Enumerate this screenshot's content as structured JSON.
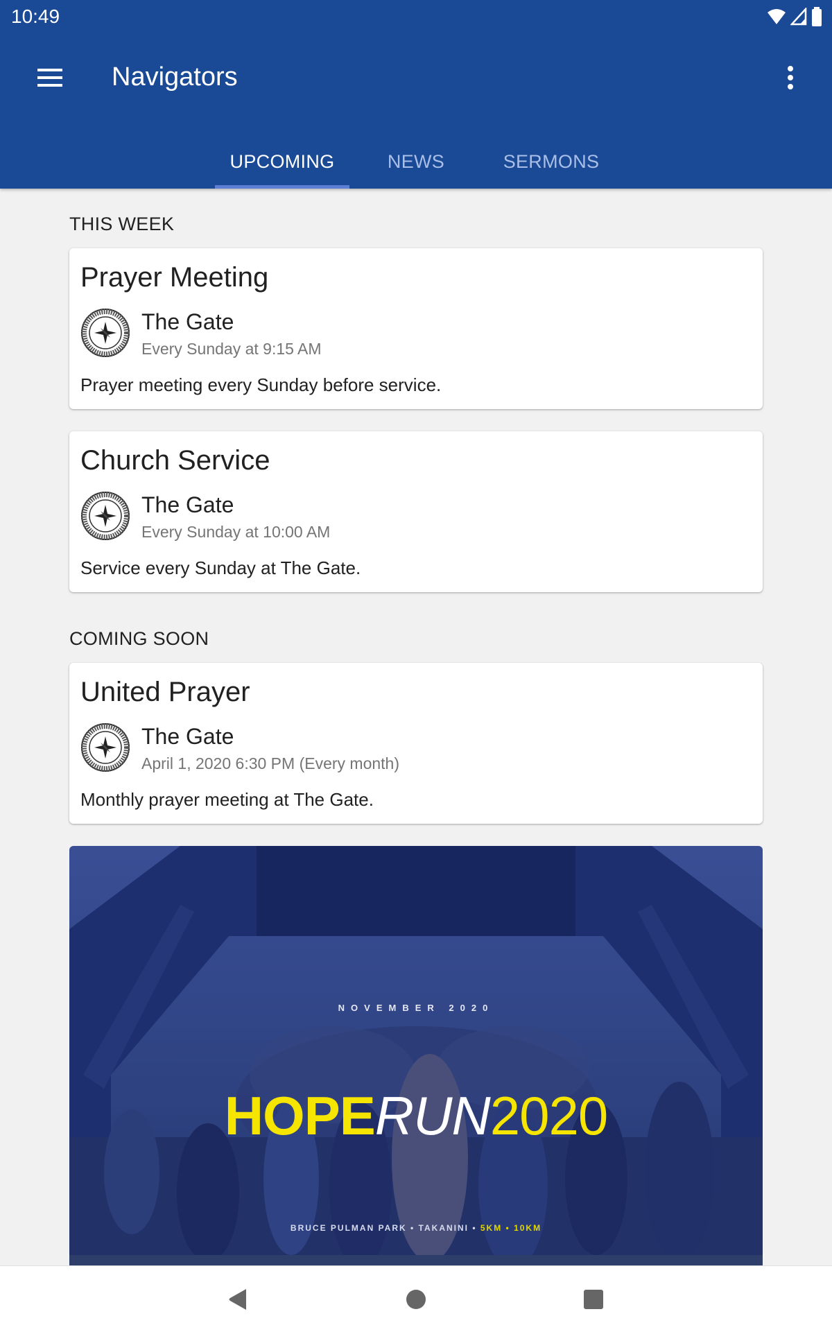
{
  "status_bar": {
    "time": "10:49",
    "icons": [
      "wifi-icon",
      "cellular-signal-icon",
      "battery-icon"
    ]
  },
  "app_bar": {
    "title": "Navigators",
    "menu_icon": "hamburger-menu-icon",
    "overflow_icon": "more-vertical-icon"
  },
  "tabs": [
    {
      "label": "UPCOMING",
      "active": true
    },
    {
      "label": "NEWS",
      "active": false
    },
    {
      "label": "SERMONS",
      "active": false
    }
  ],
  "colors": {
    "primary": "#1a4a96",
    "tab_indicator": "#5c7ed4",
    "tab_inactive": "#a9bfe8",
    "background": "#f1f1f1",
    "banner_yellow": "#f5e500"
  },
  "sections": [
    {
      "label": "THIS WEEK",
      "events": [
        {
          "title": "Prayer Meeting",
          "venue": "The Gate",
          "when": "Every Sunday at 9:15 AM",
          "description": "Prayer meeting every Sunday before service."
        },
        {
          "title": "Church Service",
          "venue": "The Gate",
          "when": "Every Sunday at 10:00 AM",
          "description": "Service every Sunday at The Gate."
        }
      ]
    },
    {
      "label": "COMING SOON",
      "events": [
        {
          "title": "United Prayer",
          "venue": "The Gate",
          "when": "April 1, 2020 6:30 PM (Every month)",
          "description": "Monthly prayer meeting at The Gate."
        }
      ]
    }
  ],
  "banner": {
    "date": "NOVEMBER 2020",
    "title_part1": "HOPE",
    "title_part2": "RUN",
    "title_part3": "2020",
    "location": "BRUCE PULMAN PARK • TAKANINI • ",
    "distances": "5KM • 10KM"
  },
  "nav_bar": {
    "back_icon": "back-triangle-icon",
    "home_icon": "home-circle-icon",
    "recents_icon": "recents-square-icon"
  }
}
